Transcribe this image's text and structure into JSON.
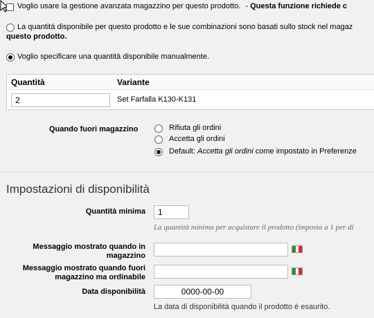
{
  "advanced_stock": {
    "checkbox_label": "Voglio usare la gestione avanzata magazzino per questo prodotto.",
    "notice_separator": "-",
    "notice_bold": "Questa funzione richiede c"
  },
  "quantity_mode": {
    "option_stock_line1": "La quantità disponibile per questo prodotto e le sue combinazioni sono basati sullo stock nel magaz",
    "option_stock_line2_bold": "questo prodotto.",
    "option_manual": "Voglio specificare una quantità disponibile manualmente."
  },
  "quantity_table": {
    "col_quantity": "Quantità",
    "col_variant": "Variante",
    "rows": [
      {
        "quantity": "2",
        "variant": "Set Farfalla K130-K131"
      }
    ]
  },
  "out_of_stock": {
    "label": "Quando fuori magazzino",
    "options": {
      "deny": "Rifiuta gli ordini",
      "accept": "Accetta gli ordini",
      "default_prefix": "Default:",
      "default_italic": "Accetta gli ordini",
      "default_suffix": "come impostato in Preferenze"
    }
  },
  "availability": {
    "section_title": "Impostazioni di disponibilità",
    "min_quantity_label": "Quantità minima",
    "min_quantity_value": "1",
    "min_quantity_hint": "La quantità minima per acquistare il prodotto (imposta a 1 per di",
    "msg_in_stock_label_1": "Messaggio mostrato quando in",
    "msg_in_stock_label_2": "magazzino",
    "msg_in_stock_value": "",
    "msg_out_stock_label_1": "Messaggio mostrato quando fuori",
    "msg_out_stock_label_2": "magazzino ma ordinabile",
    "msg_out_stock_value": "",
    "date_label": "Data disponibilità",
    "date_value": "0000-00-00",
    "date_hint": "La data di disponibilità quando il prodotto è esaurito."
  },
  "icons": {
    "language_flag": "italy-flag-icon",
    "pointer": "mouse-pointer-icon"
  }
}
